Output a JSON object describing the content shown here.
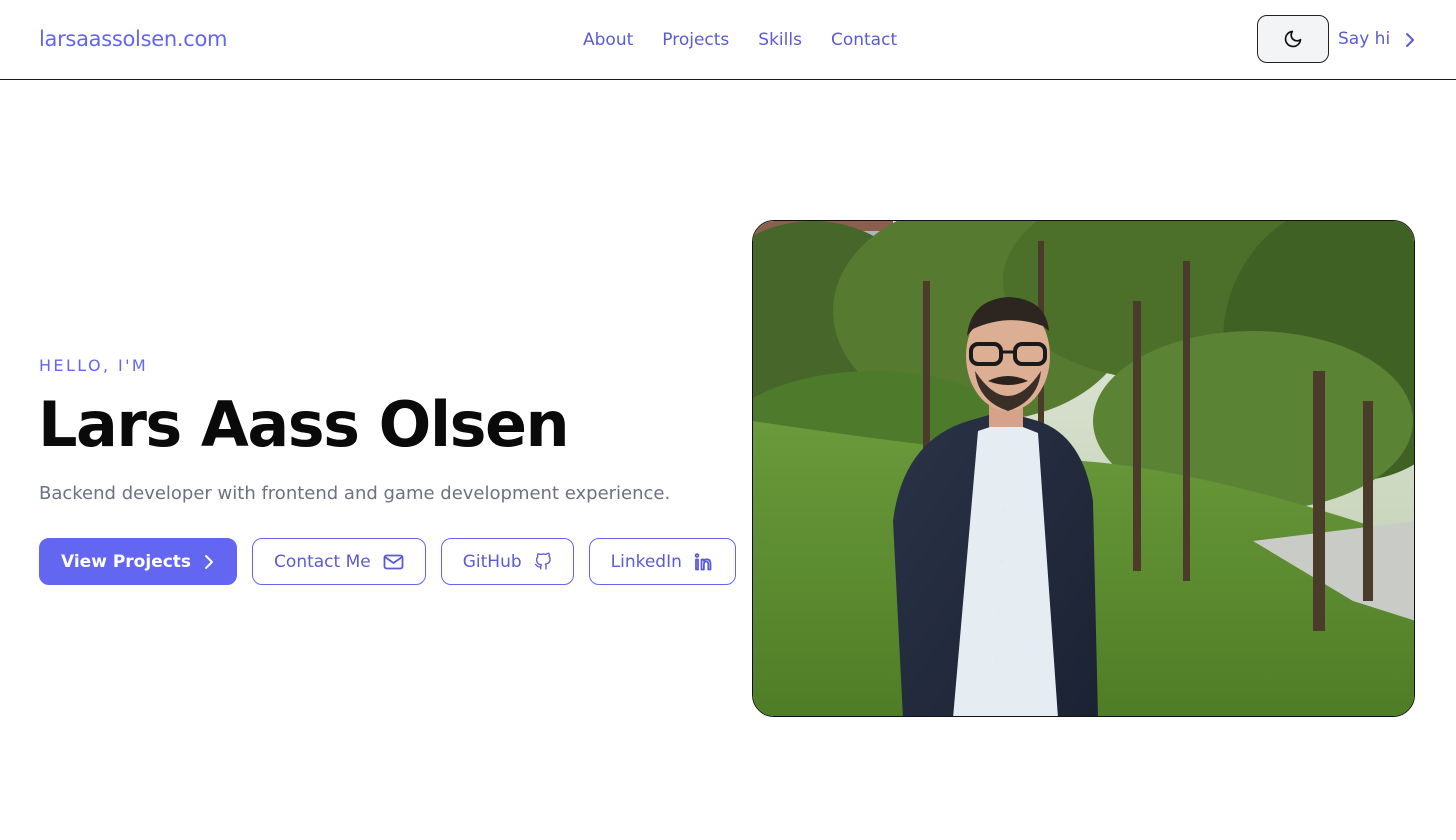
{
  "header": {
    "brand": "larsaassolsen.com",
    "nav": [
      "About",
      "Projects",
      "Skills",
      "Contact"
    ],
    "theme_toggle_icon": "moon-icon",
    "cta_label": "Say hi"
  },
  "hero": {
    "eyebrow": "HELLO, I'M",
    "name": "Lars Aass Olsen",
    "tagline": "Backend developer with frontend and game development experience.",
    "buttons": {
      "view_projects": "View Projects",
      "contact_me": "Contact Me",
      "github": "GitHub",
      "linkedin": "LinkedIn"
    },
    "photo_alt": "Portrait of Lars Aass Olsen outdoors among trees"
  },
  "colors": {
    "accent": "#6366f1",
    "text": "#0a0a0a",
    "muted": "#6b7280"
  }
}
